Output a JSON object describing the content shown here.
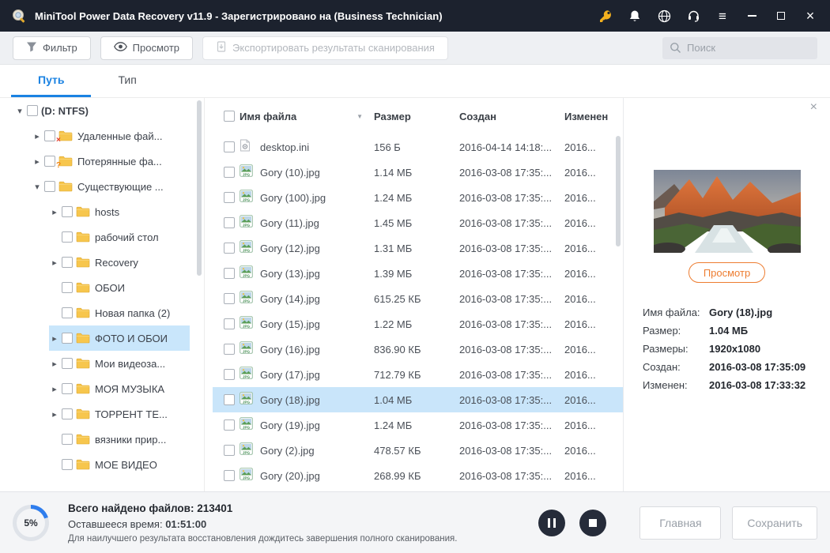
{
  "titlebar": {
    "title": "MiniTool Power Data Recovery v11.9 - Зарегистрировано на (Business Technician)"
  },
  "toolbar": {
    "filter_label": "Фильтр",
    "preview_label": "Просмотр",
    "export_label": "Экспортировать результаты сканирования",
    "search_placeholder": "Поиск"
  },
  "tabs": {
    "path": "Путь",
    "type": "Тип"
  },
  "tree": [
    {
      "label": "(D: NTFS)",
      "level": 0,
      "arrow": "down",
      "icon": "none",
      "bold": true,
      "selected": false
    },
    {
      "label": "Удаленные фай...",
      "level": 1,
      "arrow": "right",
      "icon": "folder-deleted",
      "selected": false
    },
    {
      "label": "Потерянные фа...",
      "level": 1,
      "arrow": "right",
      "icon": "folder-lost",
      "selected": false
    },
    {
      "label": "Существующие ...",
      "level": 1,
      "arrow": "down",
      "icon": "folder",
      "selected": false
    },
    {
      "label": "hosts",
      "level": 2,
      "arrow": "right",
      "icon": "folder",
      "selected": false
    },
    {
      "label": "рабочий стол",
      "level": 2,
      "arrow": "none",
      "icon": "folder",
      "selected": false
    },
    {
      "label": "Recovery",
      "level": 2,
      "arrow": "right",
      "icon": "folder",
      "selected": false
    },
    {
      "label": "ОБОИ",
      "level": 2,
      "arrow": "none",
      "icon": "folder",
      "selected": false
    },
    {
      "label": "Новая папка (2)",
      "level": 2,
      "arrow": "none",
      "icon": "folder",
      "selected": false
    },
    {
      "label": "ФОТО И ОБОИ",
      "level": 2,
      "arrow": "right",
      "icon": "folder",
      "selected": true
    },
    {
      "label": "Мои видеоза...",
      "level": 2,
      "arrow": "right",
      "icon": "folder",
      "selected": false
    },
    {
      "label": "МОЯ МУЗЫКА",
      "level": 2,
      "arrow": "right",
      "icon": "folder",
      "selected": false
    },
    {
      "label": "ТОРРЕНТ ТЕ...",
      "level": 2,
      "arrow": "right",
      "icon": "folder",
      "selected": false
    },
    {
      "label": "вязники прир...",
      "level": 2,
      "arrow": "none",
      "icon": "folder",
      "selected": false
    },
    {
      "label": "МОЕ ВИДЕО",
      "level": 2,
      "arrow": "none",
      "icon": "folder",
      "selected": false
    }
  ],
  "table": {
    "headers": {
      "name": "Имя файла",
      "size": "Размер",
      "created": "Создан",
      "modified": "Изменен"
    },
    "sort_icon": "▼",
    "rows": [
      {
        "icon": "ini",
        "name": "desktop.ini",
        "size": "156 Б",
        "created": "2016-04-14 14:18:...",
        "modified": "2016...",
        "selected": false
      },
      {
        "icon": "jpg",
        "name": "Gory (10).jpg",
        "size": "1.14 МБ",
        "created": "2016-03-08 17:35:...",
        "modified": "2016...",
        "selected": false
      },
      {
        "icon": "jpg",
        "name": "Gory (100).jpg",
        "size": "1.24 МБ",
        "created": "2016-03-08 17:35:...",
        "modified": "2016...",
        "selected": false
      },
      {
        "icon": "jpg",
        "name": "Gory (11).jpg",
        "size": "1.45 МБ",
        "created": "2016-03-08 17:35:...",
        "modified": "2016...",
        "selected": false
      },
      {
        "icon": "jpg",
        "name": "Gory (12).jpg",
        "size": "1.31 МБ",
        "created": "2016-03-08 17:35:...",
        "modified": "2016...",
        "selected": false
      },
      {
        "icon": "jpg",
        "name": "Gory (13).jpg",
        "size": "1.39 МБ",
        "created": "2016-03-08 17:35:...",
        "modified": "2016...",
        "selected": false
      },
      {
        "icon": "jpg",
        "name": "Gory (14).jpg",
        "size": "615.25 КБ",
        "created": "2016-03-08 17:35:...",
        "modified": "2016...",
        "selected": false
      },
      {
        "icon": "jpg",
        "name": "Gory (15).jpg",
        "size": "1.22 МБ",
        "created": "2016-03-08 17:35:...",
        "modified": "2016...",
        "selected": false
      },
      {
        "icon": "jpg",
        "name": "Gory (16).jpg",
        "size": "836.90 КБ",
        "created": "2016-03-08 17:35:...",
        "modified": "2016...",
        "selected": false
      },
      {
        "icon": "jpg",
        "name": "Gory (17).jpg",
        "size": "712.79 КБ",
        "created": "2016-03-08 17:35:...",
        "modified": "2016...",
        "selected": false
      },
      {
        "icon": "jpg",
        "name": "Gory (18).jpg",
        "size": "1.04 МБ",
        "created": "2016-03-08 17:35:...",
        "modified": "2016...",
        "selected": true
      },
      {
        "icon": "jpg",
        "name": "Gory (19).jpg",
        "size": "1.24 МБ",
        "created": "2016-03-08 17:35:...",
        "modified": "2016...",
        "selected": false
      },
      {
        "icon": "jpg",
        "name": "Gory (2).jpg",
        "size": "478.57 КБ",
        "created": "2016-03-08 17:35:...",
        "modified": "2016...",
        "selected": false
      },
      {
        "icon": "jpg",
        "name": "Gory (20).jpg",
        "size": "268.99 КБ",
        "created": "2016-03-08 17:35:...",
        "modified": "2016...",
        "selected": false
      }
    ]
  },
  "preview": {
    "close_icon": "×",
    "preview_button": "Просмотр",
    "fields": [
      {
        "label": "Имя файла:",
        "value": "Gory (18).jpg"
      },
      {
        "label": "Размер:",
        "value": "1.04 МБ"
      },
      {
        "label": "Размеры:",
        "value": "1920x1080"
      },
      {
        "label": "Создан:",
        "value": "2016-03-08 17:35:09"
      },
      {
        "label": "Изменен:",
        "value": "2016-03-08 17:33:32"
      }
    ]
  },
  "statusbar": {
    "progress": "5%",
    "found_label": "Всего найдено файлов:",
    "found_value": "213401",
    "time_label": "Оставшееся время:",
    "time_value": "01:51:00",
    "hint": "Для наилучшего результата восстановления дождитесь завершения полного сканирования.",
    "home_button": "Главная",
    "save_button": "Сохранить"
  },
  "colors": {
    "titlebar": "#1c222e",
    "accent_blue": "#1a82e2",
    "selection_blue": "#c9e5fa",
    "orange": "#ed7d31",
    "progress_blue": "#2f7ded",
    "key_gold": "#f2b01e"
  }
}
